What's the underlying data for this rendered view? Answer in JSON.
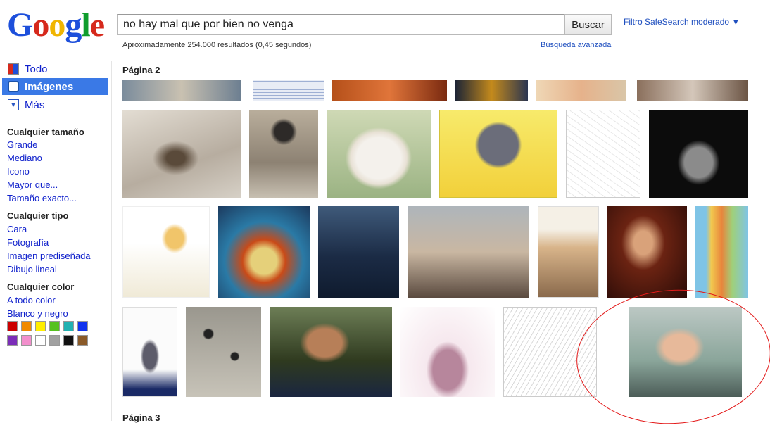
{
  "header": {
    "logo_letters": [
      {
        "ch": "G",
        "color": "#1d4fdb"
      },
      {
        "ch": "o",
        "color": "#d6291c"
      },
      {
        "ch": "o",
        "color": "#f0b501"
      },
      {
        "ch": "g",
        "color": "#1d4fdb"
      },
      {
        "ch": "l",
        "color": "#0f9d2c"
      },
      {
        "ch": "e",
        "color": "#d6291c"
      }
    ],
    "search_value": "no hay mal que por bien no venga",
    "search_button": "Buscar",
    "safesearch": "Filtro SafeSearch moderado ▼",
    "results_count": "Aproximadamente 254.000 resultados (0,45 segundos)",
    "advanced_search": "Búsqueda avanzada"
  },
  "sidebar": {
    "nav": [
      {
        "label": "Todo",
        "icon": "all-results-icon"
      },
      {
        "label": "Imágenes",
        "icon": "camera-icon",
        "active": true
      },
      {
        "label": "Más",
        "icon": "dropdown-arrow-icon"
      }
    ],
    "size_title": "Cualquier tamaño",
    "sizes": [
      "Grande",
      "Mediano",
      "Icono",
      "Mayor que...",
      "Tamaño exacto..."
    ],
    "type_title": "Cualquier tipo",
    "types": [
      "Cara",
      "Fotografía",
      "Imagen prediseñada",
      "Dibujo lineal"
    ],
    "color_title": "Cualquier color",
    "colors": [
      "A todo color",
      "Blanco y negro"
    ],
    "swatches": [
      "#cc0000",
      "#f08a00",
      "#ffee00",
      "#56c120",
      "#22b2b2",
      "#1133ee",
      "#7b2db8",
      "#f28fcc",
      "#ffffff",
      "#a1a1a1",
      "#111111",
      "#8a5a28"
    ]
  },
  "main": {
    "page2_label": "Página 2",
    "page3_label": "Página 3"
  }
}
